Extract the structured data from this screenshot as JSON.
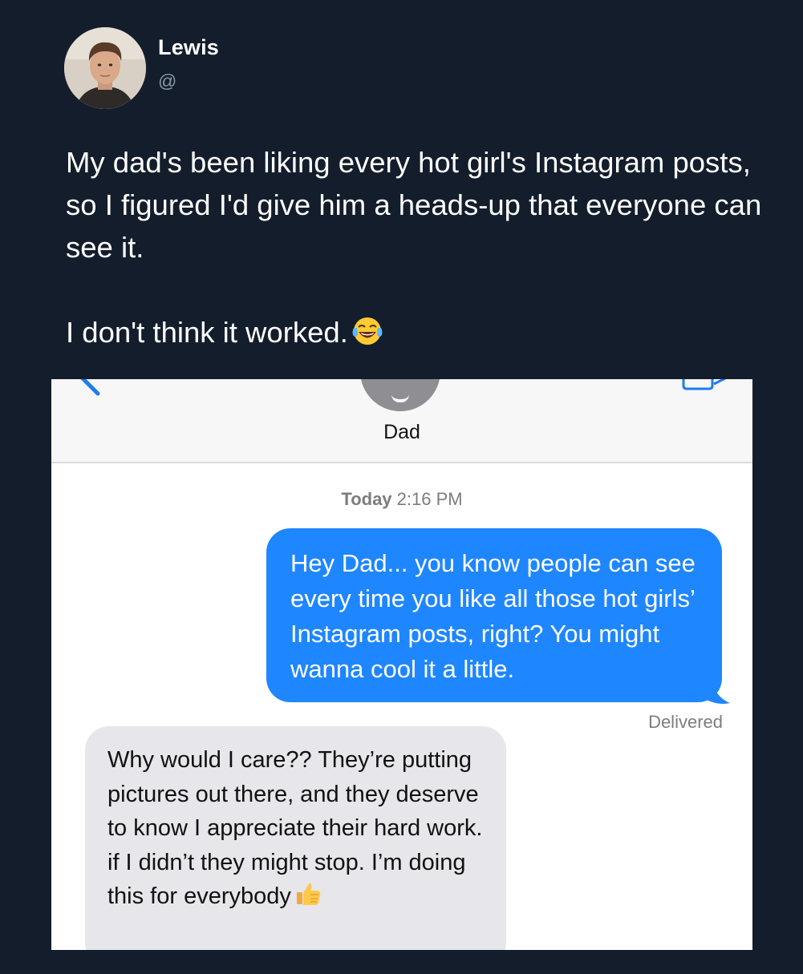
{
  "tweet": {
    "author_name": "Lewis",
    "author_handle": "@",
    "text_paragraph_1": "My dad's been liking every hot girl's Instagram posts, so I figured I'd give him a heads-up that everyone can see it.",
    "text_paragraph_2": "I don't think it worked.",
    "paragraph_2_emoji": "laughing-tears-emoji"
  },
  "screenshot": {
    "contact_name": "Dad",
    "timestamp_day": "Today",
    "timestamp_time": "2:16 PM",
    "messages": [
      {
        "direction": "outgoing",
        "text": "Hey Dad... you know people can see every time you like all those hot girls’ Instagram posts, right? You might wanna cool it a little.",
        "status": "Delivered"
      },
      {
        "direction": "incoming",
        "text": "Why would I care?? They’re putting pictures out there, and they deserve to know I appreciate their hard work. if I didn’t they might stop. I’m doing this for everybody",
        "trailing_emoji": "thumbs-up-emoji"
      }
    ]
  },
  "colors": {
    "background": "#141d2b",
    "outgoing_bubble": "#1e86ff",
    "incoming_bubble": "#e6e6eb",
    "handle_text": "#8899a6"
  }
}
